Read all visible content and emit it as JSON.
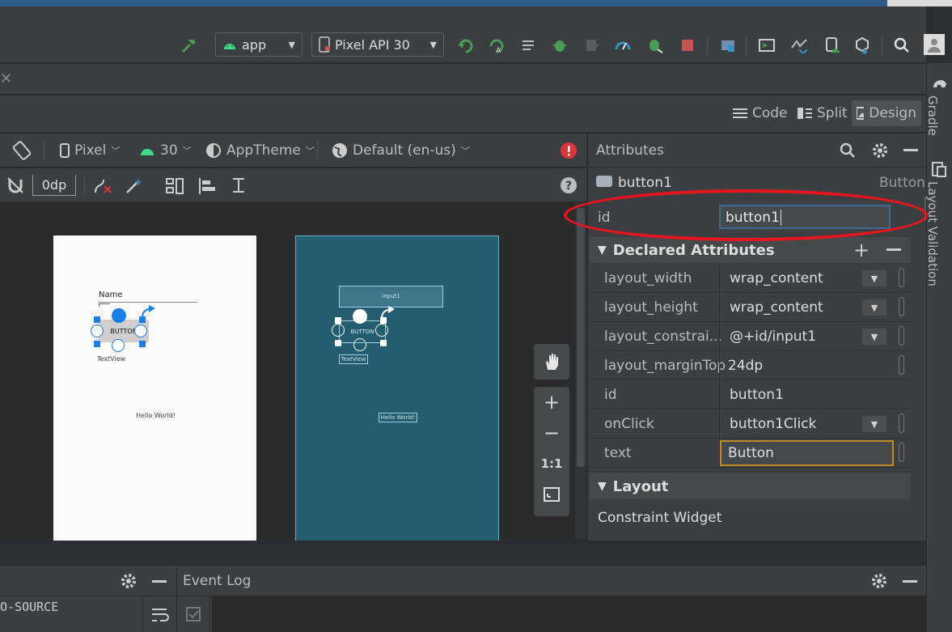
{
  "toolbar": {
    "config_label": "app",
    "device_label": "Pixel API 30"
  },
  "view_modes": {
    "code": "Code",
    "split": "Split",
    "design": "Design"
  },
  "design_bar": {
    "device": "Pixel",
    "api": "30",
    "theme": "AppTheme",
    "locale": "Default (en-us)"
  },
  "design_tools": {
    "margin": "0dp"
  },
  "preview_white": {
    "name_hint": "Name",
    "button_text": "BUTTON",
    "textview": "TextView",
    "hello": "Hello World!"
  },
  "preview_blue": {
    "input_label": "input1",
    "button_text": "BUTTON",
    "textview": "TextView",
    "hello": "Hello World!"
  },
  "zoom_controls": {
    "plus": "+",
    "minus": "−",
    "one_to_one": "1:1"
  },
  "attributes": {
    "title": "Attributes",
    "component_name": "button1",
    "component_type": "Button",
    "id_label": "id",
    "id_value": "button1",
    "declared_title": "Declared Attributes",
    "declared": [
      {
        "name": "layout_width",
        "value": "wrap_content"
      },
      {
        "name": "layout_height",
        "value": "wrap_content"
      },
      {
        "name": "layout_constrai...",
        "value": "@+id/input1"
      },
      {
        "name": "layout_marginTop",
        "value": "24dp"
      },
      {
        "name": "id",
        "value": "button1"
      },
      {
        "name": "onClick",
        "value": "button1Click"
      },
      {
        "name": "text",
        "value": "Button"
      }
    ],
    "layout_title": "Layout",
    "layout_value": "Constraint Widget"
  },
  "right_strip": {
    "gradle": "Gradle",
    "layout_validation": "Layout Validation"
  },
  "bottom": {
    "event_log_title": "Event Log",
    "left_text": "O-SOURCE"
  },
  "colors": {
    "accent_green": "#499c54",
    "annotation_red": "#e8141c",
    "stop_red": "#c75450",
    "blueprint": "#245d70"
  }
}
